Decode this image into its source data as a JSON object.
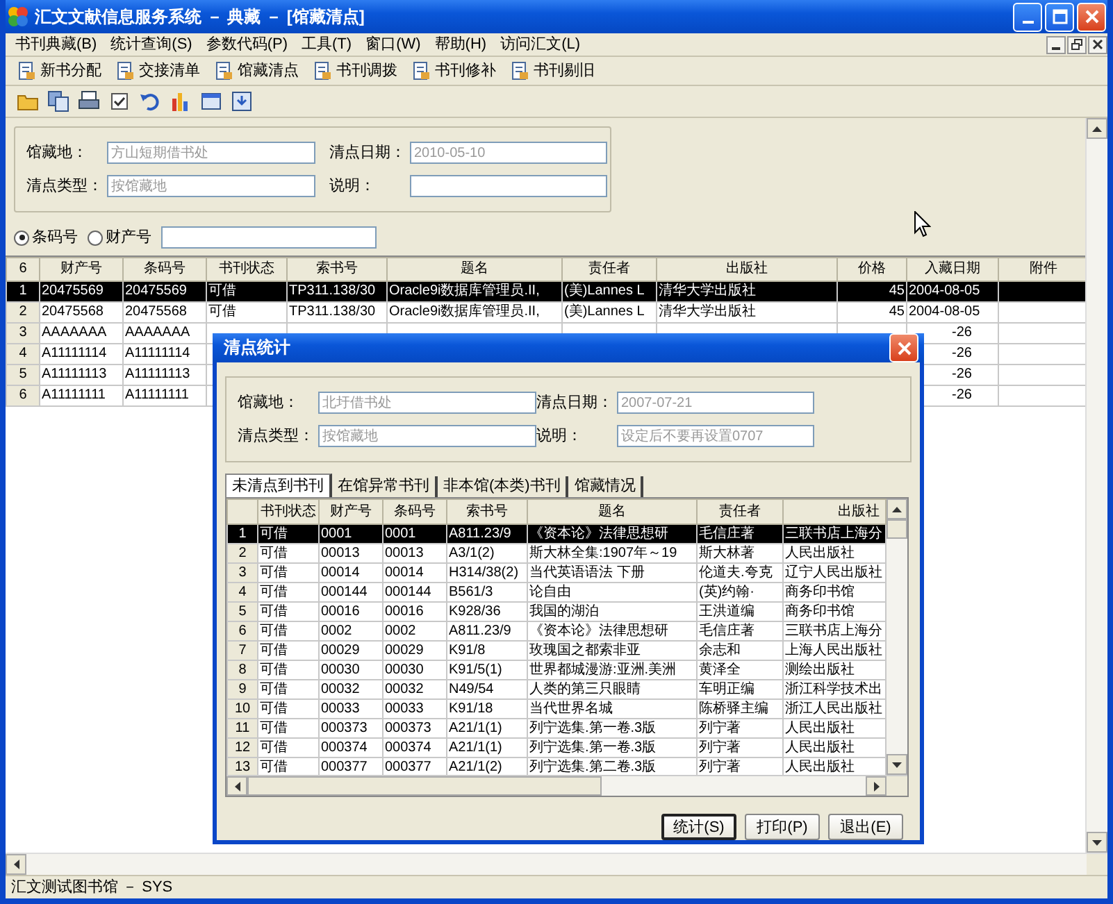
{
  "window": {
    "title": "汇文文献信息服务系统 － 典藏 － [馆藏清点]"
  },
  "menu": [
    "书刊典藏(B)",
    "统计查询(S)",
    "参数代码(P)",
    "工具(T)",
    "窗口(W)",
    "帮助(H)",
    "访问汇文(L)"
  ],
  "toolbar": [
    {
      "label": "新书分配"
    },
    {
      "label": "交接清单"
    },
    {
      "label": "馆藏清点"
    },
    {
      "label": "书刊调拨"
    },
    {
      "label": "书刊修补"
    },
    {
      "label": "书刊剔旧"
    }
  ],
  "form": {
    "fields": [
      {
        "label": "馆藏地：",
        "value": "方山短期借书处"
      },
      {
        "label": "清点日期：",
        "value": "2010-05-10"
      },
      {
        "label": "清点类型：",
        "value": "按馆藏地"
      },
      {
        "label": "说明："
      }
    ]
  },
  "search": {
    "options": [
      {
        "label": "条码号",
        "selected": true
      },
      {
        "label": "财产号",
        "selected": false
      }
    ]
  },
  "table": {
    "corner": "6",
    "columns": [
      "财产号",
      "条码号",
      "书刊状态",
      "索书号",
      "题名",
      "责任者",
      "出版社",
      "价格",
      "入藏日期",
      "附件"
    ],
    "rows": [
      {
        "num": "1",
        "selected": true,
        "covered": false,
        "cells": [
          "20475569",
          "20475569",
          "可借",
          "TP311.138/30",
          "Oracle9i数据库管理员.II,",
          "(美)Lannes L",
          "清华大学出版社",
          "45"
        ],
        "date": "2004-08-05"
      },
      {
        "num": "2",
        "selected": false,
        "covered": false,
        "cells": [
          "20475568",
          "20475568",
          "可借",
          "TP311.138/30",
          "Oracle9i数据库管理员.II,",
          "(美)Lannes L",
          "清华大学出版社",
          "45"
        ],
        "date": "2004-08-05"
      },
      {
        "num": "3",
        "selected": false,
        "covered": true,
        "cells": [
          "AAAAAAA",
          "AAAAAAA"
        ],
        "date": "-26"
      },
      {
        "num": "4",
        "selected": false,
        "covered": true,
        "cells": [
          "A11111114",
          "A11111114"
        ],
        "date": "-26"
      },
      {
        "num": "5",
        "selected": false,
        "covered": true,
        "cells": [
          "A11111113",
          "A11111113"
        ],
        "date": "-26"
      },
      {
        "num": "6",
        "selected": false,
        "covered": true,
        "cells": [
          "A11111111",
          "A11111111"
        ],
        "date": "-26"
      }
    ]
  },
  "dialog": {
    "title": "清点统计",
    "fields": [
      {
        "label": "馆藏地：",
        "value": "北圩借书处"
      },
      {
        "label": "清点日期：",
        "value": "2007-07-21"
      },
      {
        "label": "清点类型：",
        "value": "按馆藏地"
      },
      {
        "label": "说明：",
        "value": "设定后不要再设置0707"
      }
    ],
    "tabs": [
      {
        "label": "未清点到书刊",
        "selected": true
      },
      {
        "label": "在馆异常书刊",
        "selected": false
      },
      {
        "label": "非本馆(本类)书刊",
        "selected": false
      },
      {
        "label": "馆藏情况",
        "selected": false
      }
    ],
    "columns": [
      "书刊状态",
      "财产号",
      "条码号",
      "索书号",
      "题名",
      "责任者",
      "出版社"
    ],
    "rows": [
      {
        "num": "1",
        "selected": true,
        "cells": [
          "可借",
          "0001",
          "0001",
          "A811.23/9",
          "《资本论》法律思想研",
          "毛信庄著",
          "三联书店上海分"
        ]
      },
      {
        "num": "2",
        "selected": false,
        "cells": [
          "可借",
          "00013",
          "00013",
          "A3/1(2)",
          "斯大林全集:1907年～19",
          "斯大林著",
          "人民出版社"
        ]
      },
      {
        "num": "3",
        "selected": false,
        "cells": [
          "可借",
          "00014",
          "00014",
          "H314/38(2)",
          "当代英语语法 下册",
          "伦道夫.夸克",
          "辽宁人民出版社"
        ]
      },
      {
        "num": "4",
        "selected": false,
        "cells": [
          "可借",
          "000144",
          "000144",
          "B561/3",
          "论自由",
          "(英)约翰·",
          "商务印书馆"
        ]
      },
      {
        "num": "5",
        "selected": false,
        "cells": [
          "可借",
          "00016",
          "00016",
          "K928/36",
          "我国的湖泊",
          "王洪道编",
          "商务印书馆"
        ]
      },
      {
        "num": "6",
        "selected": false,
        "cells": [
          "可借",
          "0002",
          "0002",
          "A811.23/9",
          "《资本论》法律思想研",
          "毛信庄著",
          "三联书店上海分"
        ]
      },
      {
        "num": "7",
        "selected": false,
        "cells": [
          "可借",
          "00029",
          "00029",
          "K91/8",
          "玫瑰国之都索非亚",
          "余志和",
          "上海人民出版社"
        ]
      },
      {
        "num": "8",
        "selected": false,
        "cells": [
          "可借",
          "00030",
          "00030",
          "K91/5(1)",
          "世界都城漫游:亚洲.美洲",
          "黄泽全",
          "测绘出版社"
        ]
      },
      {
        "num": "9",
        "selected": false,
        "cells": [
          "可借",
          "00032",
          "00032",
          "N49/54",
          "人类的第三只眼睛",
          "车明正编",
          "浙江科学技术出"
        ]
      },
      {
        "num": "10",
        "selected": false,
        "cells": [
          "可借",
          "00033",
          "00033",
          "K91/18",
          "当代世界名城",
          "陈桥驿主编",
          "浙江人民出版社"
        ]
      },
      {
        "num": "11",
        "selected": false,
        "cells": [
          "可借",
          "000373",
          "000373",
          "A21/1(1)",
          "列宁选集.第一卷.3版",
          "列宁著",
          "人民出版社"
        ]
      },
      {
        "num": "12",
        "selected": false,
        "cells": [
          "可借",
          "000374",
          "000374",
          "A21/1(1)",
          "列宁选集.第一卷.3版",
          "列宁著",
          "人民出版社"
        ]
      },
      {
        "num": "13",
        "selected": false,
        "cells": [
          "可借",
          "000377",
          "000377",
          "A21/1(2)",
          "列宁选集.第二卷.3版",
          "列宁著",
          "人民出版社"
        ]
      }
    ],
    "buttons": [
      {
        "label": "统计(S)",
        "default": true
      },
      {
        "label": "打印(P)",
        "default": false
      },
      {
        "label": "退出(E)",
        "default": false
      }
    ]
  },
  "status_bar": "汇文测试图书馆 － SYS"
}
